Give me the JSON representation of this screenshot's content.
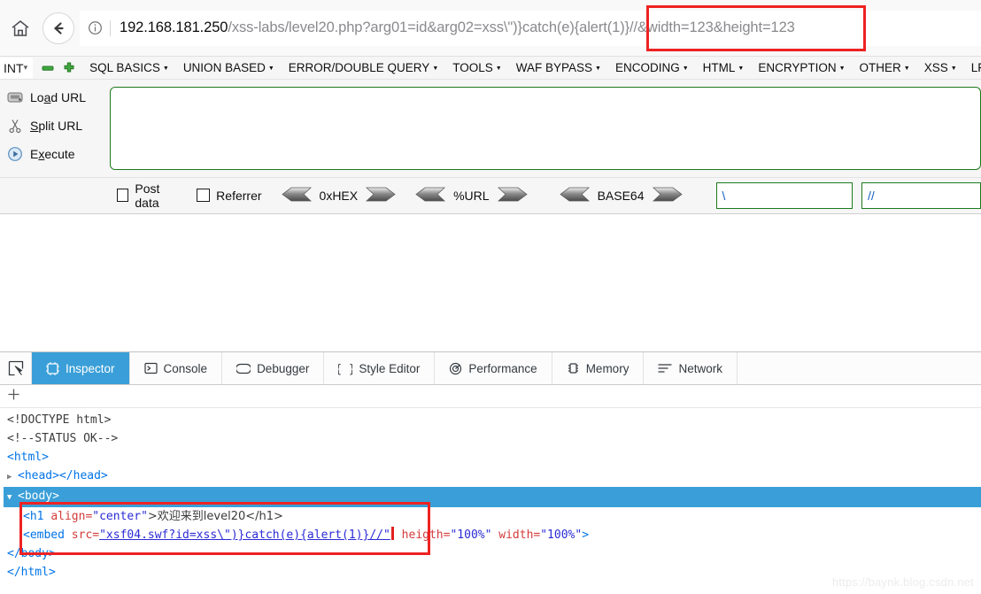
{
  "browser": {
    "home_icon": "home-icon",
    "back_icon": "back-arrow-icon",
    "info_icon": "site-info-icon",
    "url_host": "192.168.181.250",
    "url_path": "/xss-labs/level20.php?arg01=id&arg02=xss\\\")}catch(e){alert(1)}//&width=123&height=123",
    "url_full": "192.168.181.250/xss-labs/level20.php?arg01=id&arg02=xss\\\")}catch(e){alert(1)}//&width=123&height=123"
  },
  "hackbar": {
    "type_select": {
      "value": "INT",
      "caret": "chevron-down-icon"
    },
    "minus_button": "remove-tab-button",
    "plus_button": "add-tab-button",
    "menus": [
      {
        "label": "SQL BASICS"
      },
      {
        "label": "UNION BASED"
      },
      {
        "label": "ERROR/DOUBLE QUERY"
      },
      {
        "label": "TOOLS"
      },
      {
        "label": "WAF BYPASS"
      },
      {
        "label": "ENCODING"
      },
      {
        "label": "HTML"
      },
      {
        "label": "ENCRYPTION"
      },
      {
        "label": "OTHER"
      },
      {
        "label": "XSS"
      },
      {
        "label": "LFI"
      }
    ],
    "actions": [
      {
        "label": "Load URL",
        "accel": "a",
        "icon": "load-url-icon"
      },
      {
        "label": "Split URL",
        "accel": "p",
        "icon": "split-url-icon"
      },
      {
        "label": "Execute",
        "accel": "x",
        "icon": "execute-icon"
      }
    ],
    "textarea_value": "",
    "checkboxes": [
      {
        "label": "Post data",
        "checked": false
      },
      {
        "label": "Referrer",
        "checked": false
      }
    ],
    "encoders": [
      {
        "label": "0xHEX"
      },
      {
        "label": "%URL"
      },
      {
        "label": "BASE64"
      }
    ],
    "inputs": [
      {
        "value": "\\"
      },
      {
        "value": "//"
      }
    ]
  },
  "page": {
    "heading_fragment": "欢"
  },
  "devtools": {
    "picker_icon": "element-picker-icon",
    "tabs": [
      {
        "label": "Inspector",
        "icon": "inspector-icon",
        "active": true
      },
      {
        "label": "Console",
        "icon": "console-icon",
        "active": false
      },
      {
        "label": "Debugger",
        "icon": "debugger-icon",
        "active": false
      },
      {
        "label": "Style Editor",
        "icon": "style-editor-icon",
        "active": false
      },
      {
        "label": "Performance",
        "icon": "performance-icon",
        "active": false
      },
      {
        "label": "Memory",
        "icon": "memory-icon",
        "active": false
      },
      {
        "label": "Network",
        "icon": "network-icon",
        "active": false
      }
    ],
    "add_node_icon": "plus-icon",
    "markup": {
      "line_doctype": "<!DOCTYPE html>",
      "line_comment": "<!--STATUS OK-->",
      "line_html_open": "<html>",
      "line_head": "<head></head>",
      "line_body_open": "<body>",
      "line_h1_tag": "<h1",
      "line_h1_attr_name": "align=",
      "line_h1_attr_val": "\"center\"",
      "line_h1_text": ">欢迎来到level20</h1>",
      "line_embed_tag": "<embed",
      "line_embed_src_name": "src=",
      "line_embed_src_val": "\"xsf04.swf?id=xss\\\")}catch(e){alert(1)}//\"",
      "line_embed_h_name": "heigth=",
      "line_embed_h_val": "\"100%\"",
      "line_embed_w_name": "width=",
      "line_embed_w_val": "\"100%\"",
      "line_embed_close": ">",
      "line_body_close": "</body>",
      "line_html_close": "</html>"
    }
  },
  "watermark": "https://baynk.blog.csdn.net"
}
